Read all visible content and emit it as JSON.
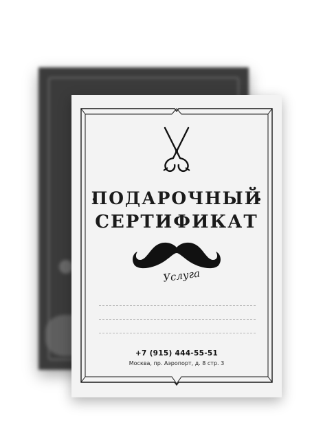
{
  "certificate": {
    "title_line1": "ПОДАРОЧНЫЙ",
    "title_line2": "СЕРТИФИКАТ",
    "service_label": "Услуга",
    "phone": "+7 (915) 444-55-51",
    "address": "Москва, пр. Аэропорт, д. 8 стр. 3"
  },
  "icons": [
    "scissors-icon",
    "mustache-icon"
  ],
  "colors": {
    "ink": "#1a1a1a",
    "card_front": "#f3f3f3",
    "card_back": "#3b3b3b"
  }
}
